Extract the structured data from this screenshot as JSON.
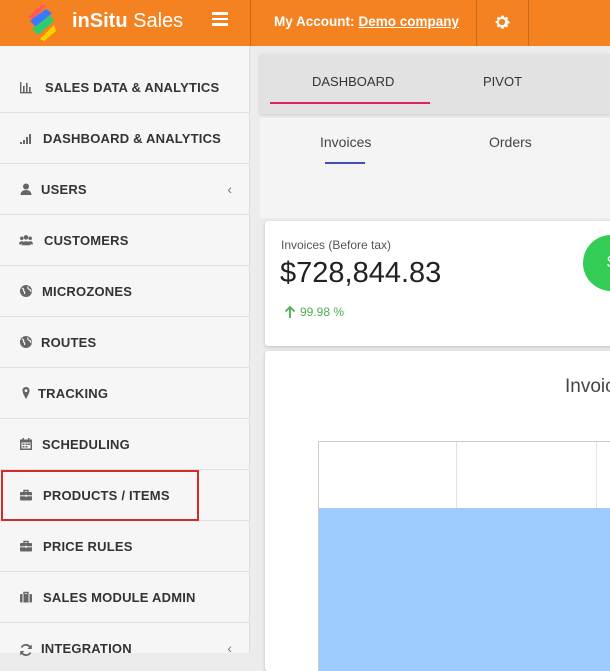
{
  "header": {
    "brand_bold": "inSitu",
    "brand_rest": " Sales",
    "account_label": "My Account:",
    "account_company": "Demo company"
  },
  "sidebar": {
    "items": [
      {
        "label": "SALES DATA & ANALYTICS",
        "icon": "bar-chart-icon"
      },
      {
        "label": "DASHBOARD & ANALYTICS",
        "icon": "signal-icon"
      },
      {
        "label": "USERS",
        "icon": "user-icon",
        "chevron": "‹"
      },
      {
        "label": "CUSTOMERS",
        "icon": "users-icon"
      },
      {
        "label": "MICROZONES",
        "icon": "globe-icon"
      },
      {
        "label": "ROUTES",
        "icon": "globe-icon"
      },
      {
        "label": "TRACKING",
        "icon": "map-marker-icon"
      },
      {
        "label": "SCHEDULING",
        "icon": "calendar-icon"
      },
      {
        "label": "PRODUCTS / ITEMS",
        "icon": "briefcase-icon"
      },
      {
        "label": "PRICE RULES",
        "icon": "briefcase-icon"
      },
      {
        "label": "SALES MODULE ADMIN",
        "icon": "suitcase-icon"
      },
      {
        "label": "INTEGRATION",
        "icon": "refresh-icon",
        "chevron": "‹"
      }
    ]
  },
  "main": {
    "tabs": [
      {
        "label": "DASHBOARD"
      },
      {
        "label": "PIVOT"
      }
    ],
    "subtabs": [
      {
        "label": "Invoices"
      },
      {
        "label": "Orders"
      }
    ],
    "card": {
      "title": "Invoices (Before tax)",
      "value": "$728,844.83",
      "trend": "99.98 %",
      "circle_text": "$"
    },
    "chart": {
      "title": "Invoic"
    }
  },
  "colors": {
    "topbar": "#f58220",
    "tab_underline": "#e0245e",
    "subtab_underline": "#3f51b5",
    "trend_green": "#4caf50",
    "bar_fill": "#9ecbff",
    "highlight": "#d42a2a"
  }
}
